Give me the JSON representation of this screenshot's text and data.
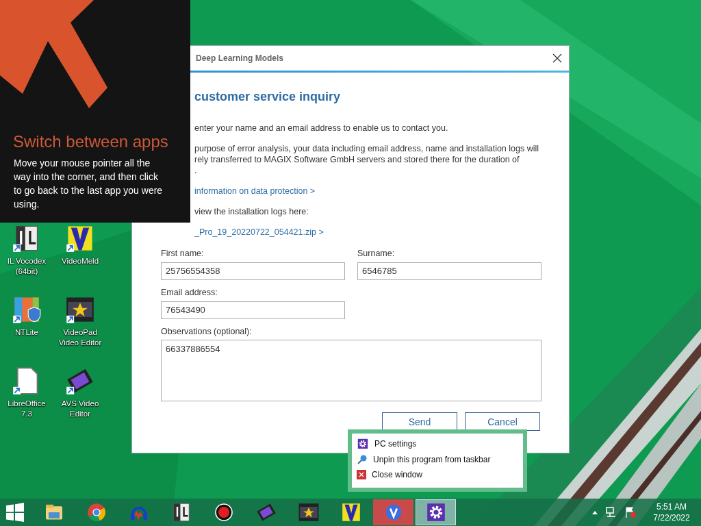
{
  "tip": {
    "title": "Switch between apps",
    "body": "Move your mouse pointer all the way into the corner, and then click to go back to the last app you were using."
  },
  "desktop_icons": [
    {
      "kind": "il",
      "label": "IL Vocodex\n(64bit)"
    },
    {
      "kind": "videomeld",
      "label": "VideoMeld"
    },
    {
      "kind": "ntlite",
      "label": "NTLite"
    },
    {
      "kind": "videopad",
      "label": "VideoPad\nVideo Editor"
    },
    {
      "kind": "libreoffice",
      "label": "LibreOffice\n7.3"
    },
    {
      "kind": "avs",
      "label": "AVS Video\nEditor"
    }
  ],
  "dialog": {
    "title": "Deep Learning Models",
    "heading": "customer service inquiry",
    "paragraphs": [
      {
        "kind": "text",
        "lines": [
          "enter your name and an email address to enable us to contact you."
        ]
      },
      {
        "kind": "text",
        "lines": [
          "purpose of error analysis, your data including email address, name and installation logs will",
          "rely transferred to MAGIX Software GmbH servers and stored there for the duration of",
          "."
        ]
      },
      {
        "kind": "link",
        "lines": [
          "information on data protection >"
        ]
      },
      {
        "kind": "text",
        "lines": [
          "view the installation logs here:"
        ]
      },
      {
        "kind": "link",
        "lines": [
          "_Pro_19_20220722_054421.zip >"
        ]
      }
    ],
    "fields": [
      {
        "kind": "input",
        "label": "First name:",
        "value": "25756554358"
      },
      {
        "kind": "input",
        "label": "Surname:",
        "value": "6546785"
      },
      {
        "kind": "input",
        "label": "Email address:",
        "value": "76543490"
      },
      {
        "kind": "textarea",
        "label": "Observations (optional):",
        "value": "66337886554"
      }
    ],
    "buttons": [
      "Send",
      "Cancel"
    ]
  },
  "context_menu": [
    {
      "kind": "gear",
      "label": "PC settings"
    },
    {
      "kind": "pin",
      "label": "Unpin this program from taskbar"
    },
    {
      "kind": "close",
      "label": "Close window"
    }
  ],
  "taskbar": {
    "apps": [
      {
        "kind": "explorer",
        "selected": false
      },
      {
        "kind": "chrome",
        "selected": false
      },
      {
        "kind": "audio",
        "selected": false
      },
      {
        "kind": "il",
        "selected": false
      },
      {
        "kind": "record",
        "selected": false
      },
      {
        "kind": "avs",
        "selected": false
      },
      {
        "kind": "videopad",
        "selected": false
      },
      {
        "kind": "videomeld",
        "selected": false
      },
      {
        "kind": "vivaldi",
        "selected": false
      },
      {
        "kind": "settings",
        "selected": true
      }
    ],
    "time": "5:51 AM",
    "date": "7/22/2022"
  }
}
